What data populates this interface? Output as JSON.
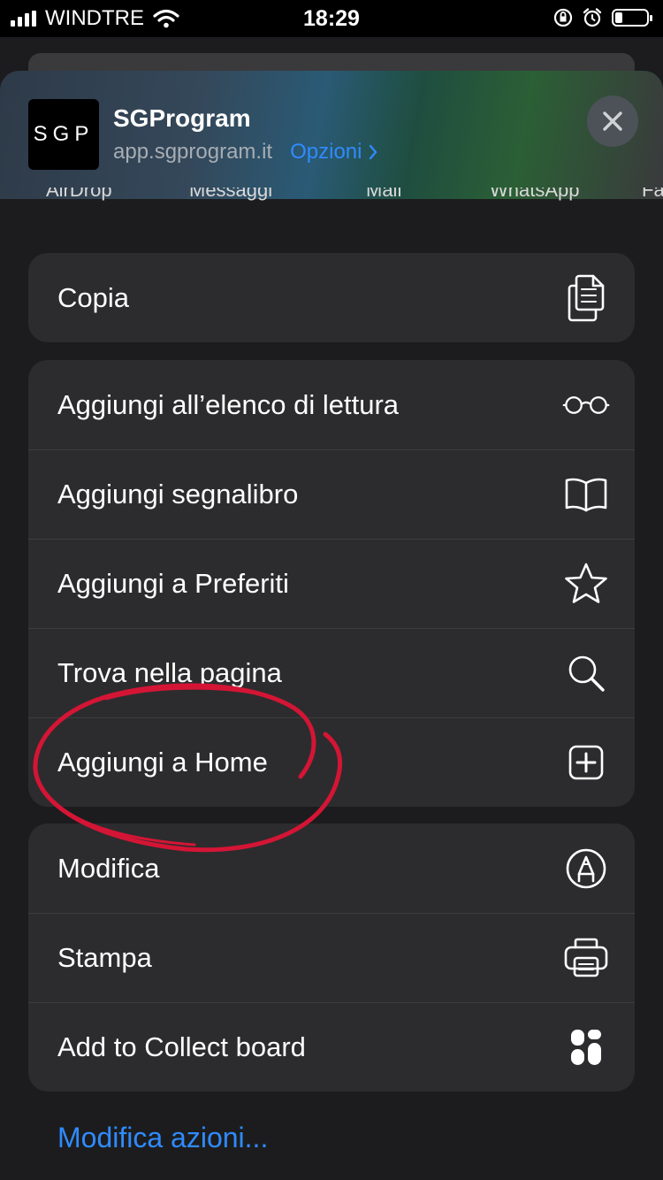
{
  "status_bar": {
    "carrier": "WINDTRE",
    "time": "18:29"
  },
  "app": {
    "icon_text": "SGP",
    "name": "SGProgram",
    "url": "app.sgprogram.it",
    "options_label": "Opzioni"
  },
  "share_targets": [
    "AirDrop",
    "Messaggi",
    "Mail",
    "WhatsApp",
    "Fa"
  ],
  "actions": {
    "group1": [
      {
        "label": "Copia",
        "icon": "copy-icon"
      }
    ],
    "group2": [
      {
        "label": "Aggiungi all’elenco di lettura",
        "icon": "glasses-icon"
      },
      {
        "label": "Aggiungi segnalibro",
        "icon": "book-icon"
      },
      {
        "label": "Aggiungi a Preferiti",
        "icon": "star-icon"
      },
      {
        "label": "Trova nella pagina",
        "icon": "search-icon"
      },
      {
        "label": "Aggiungi a Home",
        "icon": "plus-square-icon"
      }
    ],
    "group3": [
      {
        "label": "Modifica",
        "icon": "markup-icon"
      },
      {
        "label": "Stampa",
        "icon": "printer-icon"
      },
      {
        "label": "Add to Collect board",
        "icon": "collect-icon"
      }
    ]
  },
  "edit_actions_label": "Modifica azioni...",
  "colors": {
    "accent": "#2f8bff",
    "annotation": "#d41535",
    "sheet": "#1c1c1e",
    "row": "#2c2c2e"
  }
}
